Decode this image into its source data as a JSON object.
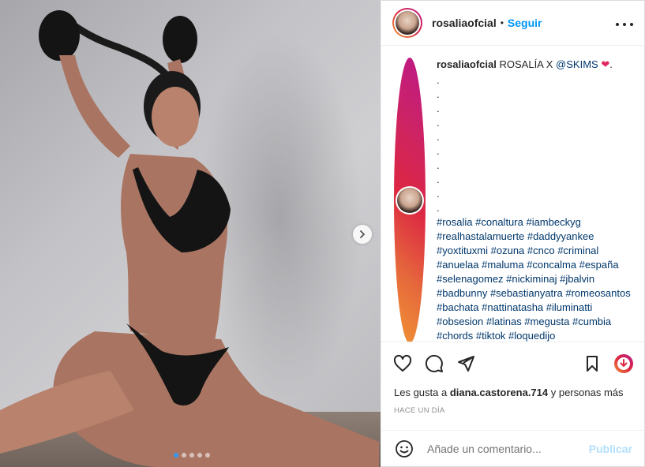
{
  "post": {
    "username": "rosaliaofcial",
    "follow_label": "Seguir",
    "bullet": "•",
    "more_label": "•••"
  },
  "caption": {
    "username": "rosaliaofcial",
    "text_before": "ROSALÍA X ",
    "mention": "@SKIMS",
    "heart": "❤",
    "period": ".",
    "dots": [
      ".",
      ".",
      ".",
      ".",
      ".",
      ".",
      ".",
      ".",
      ".",
      "."
    ],
    "hashtags": "#rosalia #conaltura #iambeckyg #realhastalamuerte #daddyyankee #yoxtituxmi #ozuna #cnco #criminal #anuelaa #maluma #concalma #españa #selenagomez #nickiminaj #jbalvin #badbunny #sebastianyatra #romeosantos #bachata #nattinatasha #iluminatti #obsesion #latinas #megusta #cumbia #chords #tiktok #loquedijo"
  },
  "likes": {
    "prefix": "Les gusta a ",
    "user": "diana.castorena.714",
    "suffix": " y personas más"
  },
  "timestamp": "HACE UN DÍA",
  "comment": {
    "placeholder": "Añade un comentario...",
    "publish_label": "Publicar"
  },
  "carousel": {
    "total": 5,
    "active_index": 0
  },
  "icons": {
    "like": "heart-icon",
    "comment": "comment-icon",
    "share": "send-icon",
    "save": "bookmark-icon",
    "emoji": "emoji-icon",
    "next": "chevron-right-icon",
    "more": "more-options-icon"
  },
  "colors": {
    "link": "#0095f6",
    "hashtag": "#00376b",
    "muted": "#8e8e8e",
    "publish_disabled": "#b2dffc"
  }
}
